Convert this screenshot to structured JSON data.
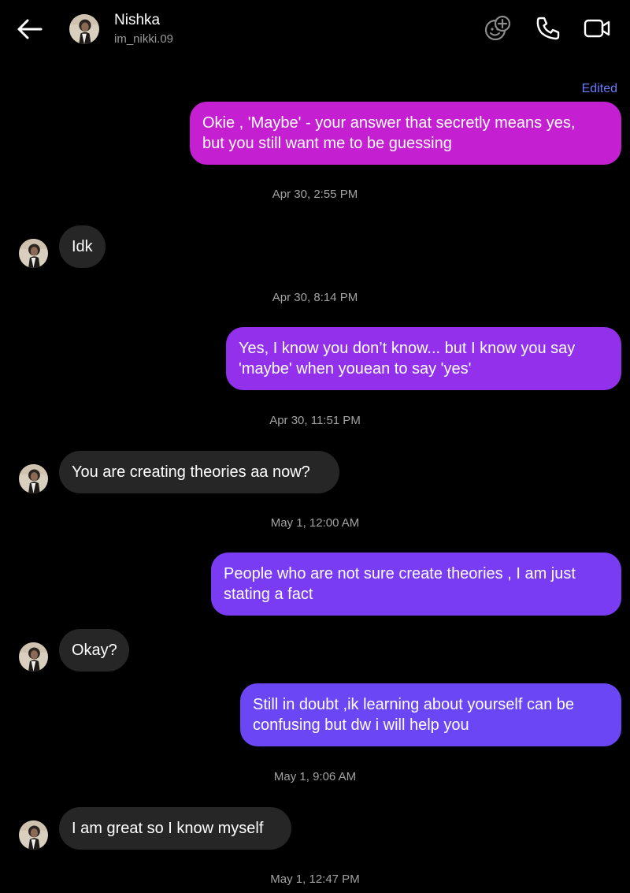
{
  "header": {
    "name": "Nishka",
    "username": "im_nikki.09"
  },
  "icons": {
    "back": "back-arrow-icon",
    "effects": "add-effect-icon",
    "call": "phone-icon",
    "video": "video-call-icon"
  },
  "colors": {
    "bubble_out_1": "#c41fd1",
    "bubble_out_2": "#9230ec",
    "bubble_out_3": "#7a3cf2",
    "bubble_out_4": "#6b46f5",
    "bubble_in": "#262626",
    "edited": "#6b7bff"
  },
  "messages": {
    "edited_label": "Edited",
    "m1": "Okie , 'Maybe' - your answer that secretly means yes,\nbut you still want me  to be guessing",
    "t1": "Apr 30, 2:55 PM",
    "m2": "Idk",
    "t2": "Apr 30, 8:14 PM",
    "m3": "Yes, I know you don’t know... but I know you say\n'maybe' when youean to say 'yes'",
    "t3": "Apr 30, 11:51 PM",
    "m4": "You are creating theories aa now?",
    "t4": "May 1, 12:00 AM",
    "m5": "People who are not sure create theories , I am just\nstating a fact",
    "m6": "Okay?",
    "m7": "Still in doubt ,ik learning about yourself can be\nconfusing but dw i will help you",
    "t5": "May 1, 9:06 AM",
    "m8": "I am great so I know myself",
    "t6": "May 1, 12:47 PM"
  }
}
